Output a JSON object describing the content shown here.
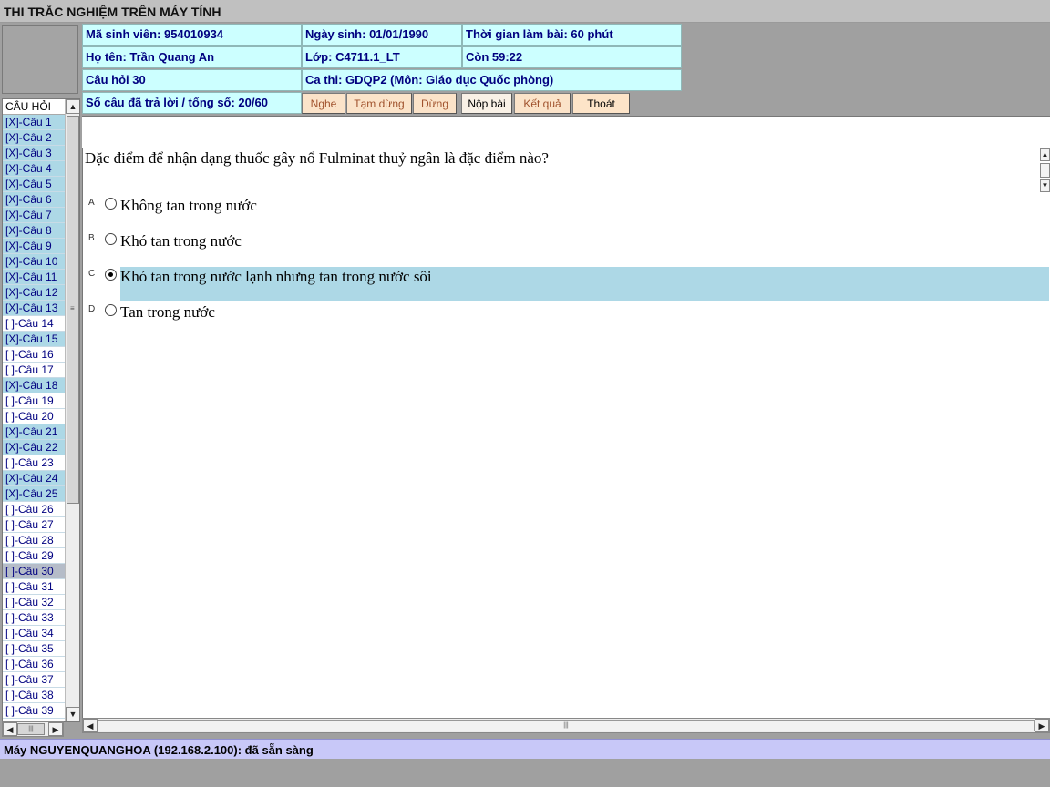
{
  "window": {
    "title": "THI TRẮC NGHIỆM TRÊN MÁY TÍNH"
  },
  "info": {
    "student_id": "Mã sinh viên: 954010934",
    "dob": "Ngày sinh: 01/01/1990",
    "duration": "Thời gian làm bài: 60 phút",
    "name": "Họ tên: Trần Quang An",
    "class": "Lớp: C4711.1_LT",
    "remaining": "Còn 59:22",
    "question_no": "Câu hỏi 30",
    "session": "Ca thi: GDQP2 (Môn: Giáo dục Quốc phòng)",
    "answered_count": "Số câu đã trả lời / tổng số: 20/60"
  },
  "toolbar": {
    "listen": "Nghe",
    "pause": "Tạm dừng",
    "stop": "Dừng",
    "submit": "Nộp bài",
    "result": "Kết quả",
    "exit": "Thoát"
  },
  "question_list": {
    "header": "CÂU HỎI",
    "items": [
      {
        "label": "[X]-Câu 1",
        "state": "answered"
      },
      {
        "label": "[X]-Câu 2",
        "state": "answered"
      },
      {
        "label": "[X]-Câu 3",
        "state": "answered"
      },
      {
        "label": "[X]-Câu 4",
        "state": "answered"
      },
      {
        "label": "[X]-Câu 5",
        "state": "answered"
      },
      {
        "label": "[X]-Câu 6",
        "state": "answered"
      },
      {
        "label": "[X]-Câu 7",
        "state": "answered"
      },
      {
        "label": "[X]-Câu 8",
        "state": "answered"
      },
      {
        "label": "[X]-Câu 9",
        "state": "answered"
      },
      {
        "label": "[X]-Câu 10",
        "state": "answered"
      },
      {
        "label": "[X]-Câu 11",
        "state": "answered"
      },
      {
        "label": "[X]-Câu 12",
        "state": "answered"
      },
      {
        "label": "[X]-Câu 13",
        "state": "answered"
      },
      {
        "label": "[ ]-Câu 14",
        "state": "blank"
      },
      {
        "label": "[X]-Câu 15",
        "state": "answered"
      },
      {
        "label": "[ ]-Câu 16",
        "state": "blank"
      },
      {
        "label": "[ ]-Câu 17",
        "state": "blank"
      },
      {
        "label": "[X]-Câu 18",
        "state": "answered"
      },
      {
        "label": "[ ]-Câu 19",
        "state": "blank"
      },
      {
        "label": "[ ]-Câu 20",
        "state": "blank"
      },
      {
        "label": "[X]-Câu 21",
        "state": "answered"
      },
      {
        "label": "[X]-Câu 22",
        "state": "answered"
      },
      {
        "label": "[ ]-Câu 23",
        "state": "blank"
      },
      {
        "label": "[X]-Câu 24",
        "state": "answered"
      },
      {
        "label": "[X]-Câu 25",
        "state": "answered"
      },
      {
        "label": "[ ]-Câu 26",
        "state": "blank"
      },
      {
        "label": "[ ]-Câu 27",
        "state": "blank"
      },
      {
        "label": "[ ]-Câu 28",
        "state": "blank"
      },
      {
        "label": "[ ]-Câu 29",
        "state": "blank"
      },
      {
        "label": "[ ]-Câu 30",
        "state": "current"
      },
      {
        "label": "[ ]-Câu 31",
        "state": "blank"
      },
      {
        "label": "[ ]-Câu 32",
        "state": "blank"
      },
      {
        "label": "[ ]-Câu 33",
        "state": "blank"
      },
      {
        "label": "[ ]-Câu 34",
        "state": "blank"
      },
      {
        "label": "[ ]-Câu 35",
        "state": "blank"
      },
      {
        "label": "[ ]-Câu 36",
        "state": "blank"
      },
      {
        "label": "[ ]-Câu 37",
        "state": "blank"
      },
      {
        "label": "[ ]-Câu 38",
        "state": "blank"
      },
      {
        "label": "[ ]-Câu 39",
        "state": "blank"
      }
    ]
  },
  "question": {
    "text": "Đặc điểm để nhận dạng thuốc gây nổ Fulminat thuỷ ngân là đặc điểm nào?",
    "options": [
      {
        "letter": "A",
        "text": "Không tan trong nước",
        "selected": false
      },
      {
        "letter": "B",
        "text": "Khó tan trong nước",
        "selected": false
      },
      {
        "letter": "C",
        "text": "Khó tan trong nước lạnh nhưng tan trong nước sôi",
        "selected": true
      },
      {
        "letter": "D",
        "text": "Tan trong nước",
        "selected": false
      }
    ]
  },
  "icons": {
    "scroll_up": "scroll-up-arrow-icon",
    "scroll_down": "scroll-down-arrow-icon",
    "scroll_left": "scroll-left-arrow-icon",
    "scroll_right": "scroll-right-arrow-icon"
  },
  "colors": {
    "info_bg": "#ccffff",
    "answered_bg": "#add8e6",
    "current_bg": "#b5bcc8",
    "selected_option_bg": "#add8e6",
    "status_bg": "#c8c8f8",
    "info_text": "#000080"
  },
  "status": {
    "text": "Máy NGUYENQUANGHOA (192.168.2.100): đã sẵn sàng"
  }
}
